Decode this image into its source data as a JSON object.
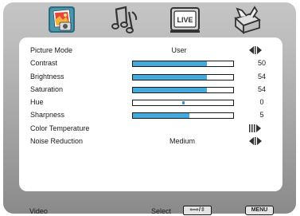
{
  "tabs": [
    {
      "icon": "picture-icon",
      "selected": true
    },
    {
      "icon": "music-icon",
      "selected": false
    },
    {
      "icon": "live-tv-icon",
      "label": "LIVE",
      "selected": false
    },
    {
      "icon": "toolbox-icon",
      "selected": false
    }
  ],
  "menu": {
    "picture_mode": {
      "label": "Picture Mode",
      "value": "User"
    },
    "contrast": {
      "label": "Contrast",
      "value": "50",
      "level": 0.74
    },
    "brightness": {
      "label": "Brightness",
      "value": "54",
      "level": 0.74
    },
    "saturation": {
      "label": "Saturation",
      "value": "54",
      "level": 0.74
    },
    "hue": {
      "label": "Hue",
      "value": "0",
      "level": 0.5
    },
    "sharpness": {
      "label": "Sharpness",
      "value": "5",
      "level": 0.56
    },
    "color_temperature": {
      "label": "Color Temperature"
    },
    "noise_reduction": {
      "label": "Noise Reduction",
      "value": "Medium"
    }
  },
  "footer": {
    "source": "Video",
    "select": "Select",
    "nav_key": "⇦⇨/⇳",
    "menu_key": "MENU"
  },
  "colors": {
    "bar_fill": "#45a9dc",
    "frame": "#bcbcbc",
    "panel": "#ffffff"
  }
}
